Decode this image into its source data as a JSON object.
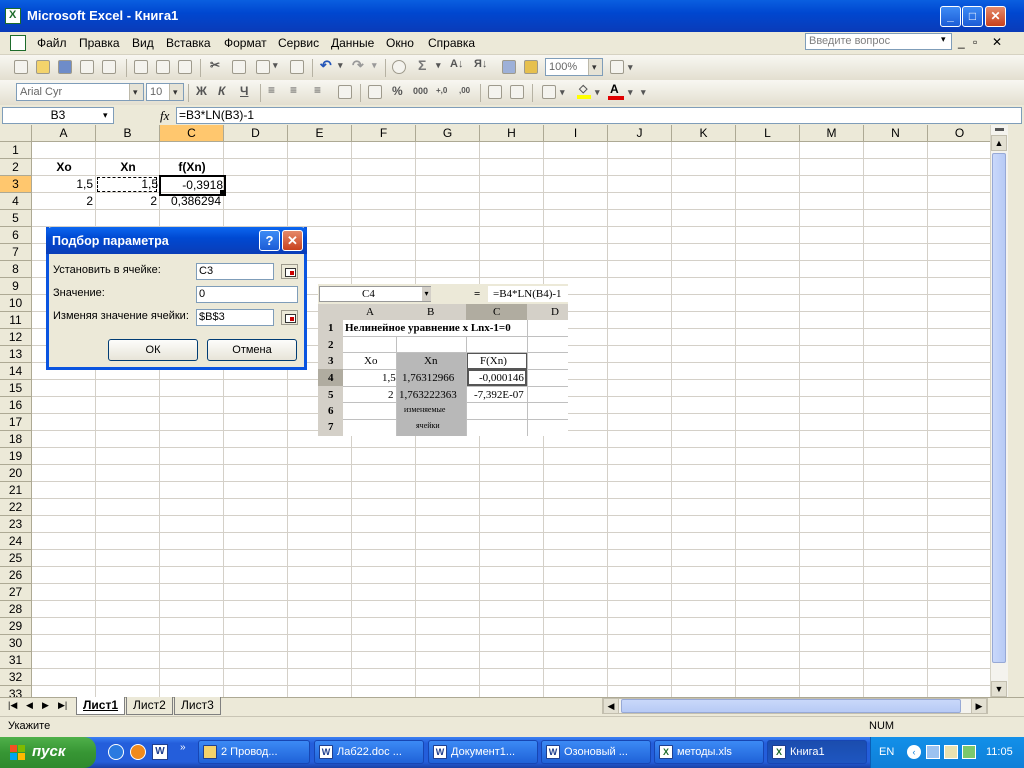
{
  "window": {
    "title": "Microsoft Excel - Книга1",
    "min": "_",
    "max": "□",
    "close": "✕"
  },
  "menu": {
    "items": [
      "Файл",
      "Правка",
      "Вид",
      "Вставка",
      "Формат",
      "Сервис",
      "Данные",
      "Окно",
      "Справка"
    ],
    "help_placeholder": "Введите вопрос",
    "doc_min": "_",
    "doc_restore": "▫",
    "doc_close": "✕"
  },
  "toolbar1": {
    "zoom": "100%",
    "sigma": "Σ"
  },
  "toolbar2": {
    "font": "Arial Cyr",
    "size": "10",
    "bold": "Ж",
    "italic": "К",
    "underline": "Ч",
    "percent": "%",
    "thousands": "000",
    "dec_inc": "+,0",
    "dec_dec": ",00",
    "font_color_glyph": "A"
  },
  "formula_bar": {
    "name_box": "B3",
    "fx": "fx",
    "formula": "=B3*LN(B3)-1"
  },
  "grid": {
    "columns": [
      "A",
      "B",
      "C",
      "D",
      "E",
      "F",
      "G",
      "H",
      "I",
      "J",
      "K",
      "L",
      "M",
      "N",
      "O"
    ],
    "rows": [
      "1",
      "2",
      "3",
      "4",
      "5",
      "6",
      "7",
      "8",
      "9",
      "10",
      "11",
      "12",
      "13",
      "14",
      "15",
      "16",
      "17",
      "18",
      "19",
      "20",
      "21",
      "22",
      "23",
      "24",
      "25",
      "26",
      "27",
      "28",
      "29",
      "30",
      "31",
      "32",
      "33"
    ],
    "cells": {
      "A2": "Xo",
      "B2": "Xn",
      "C2": "f(Xn)",
      "A3": "1,5",
      "B3": "1,5",
      "C3": "-0,3918",
      "A4": "2",
      "B4": "2",
      "C4": "0,386294"
    }
  },
  "dialog": {
    "title": "Подбор параметра",
    "help": "?",
    "close": "✕",
    "set_cell_label": "Установить в ячейке:",
    "set_cell_value": "C3",
    "value_label": "Значение:",
    "value_value": "0",
    "changing_label": "Изменяя значение ячейки:",
    "changing_value": "$B$3",
    "ok": "ОК",
    "cancel": "Отмена"
  },
  "picture": {
    "name_box": "C4",
    "eq": "=",
    "formula": "=B4*LN(B4)-1",
    "cols": [
      "A",
      "B",
      "C",
      "D"
    ],
    "rows": [
      "1",
      "2",
      "3",
      "4",
      "5",
      "6",
      "7"
    ],
    "title": "Нелинейное уравнение  x Lnx-1=0",
    "h_xo": "Xo",
    "h_xn": "Xn",
    "h_fxn": "F(Xn)",
    "a4": "1,5",
    "b4": "1,76312966",
    "c4": "-0,000146",
    "a5": "2",
    "b5": "1,763222363",
    "c5": "-7,392E-07",
    "note1": "изменяемые",
    "note2": "ячейки"
  },
  "sheets": {
    "tabs": [
      "Лист1",
      "Лист2",
      "Лист3"
    ],
    "active": 0
  },
  "status": {
    "left": "Укажите",
    "num": "NUM"
  },
  "taskbar": {
    "start": "пуск",
    "buttons": [
      "2 Провод...",
      "Лаб22.doc ...",
      "Документ1...",
      "Озоновый ...",
      "методы.xls",
      "Книга1"
    ],
    "lang": "EN",
    "clock": "11:05"
  }
}
